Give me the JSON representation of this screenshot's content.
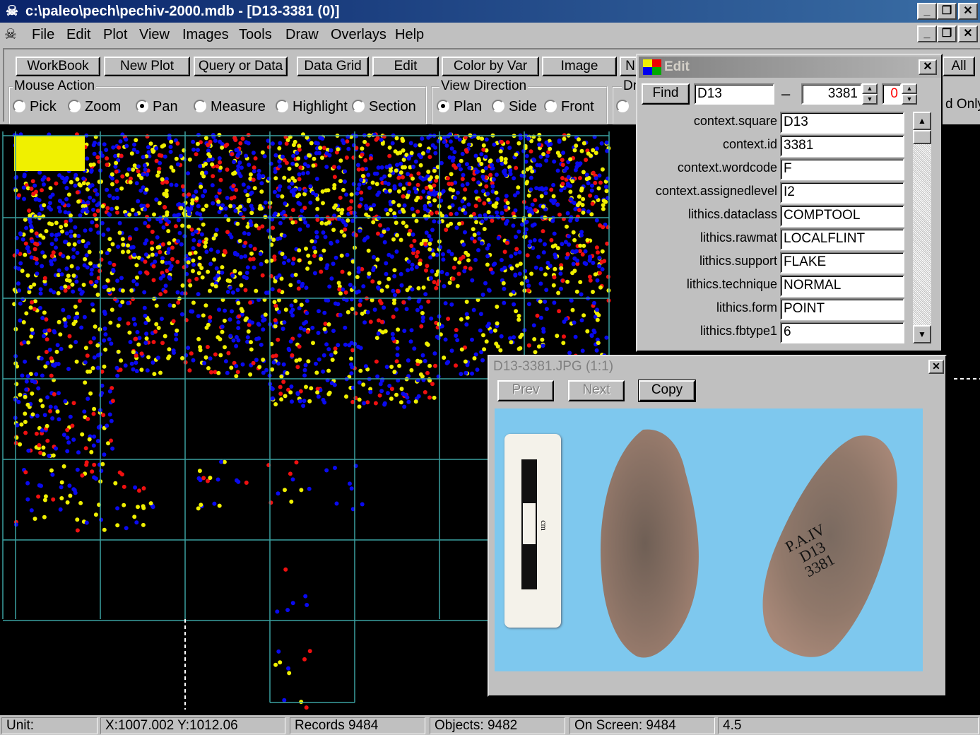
{
  "window": {
    "title": "c:\\paleo\\pech\\pechiv-2000.mdb - [D13-3381 (0)]",
    "skull_icon": "skull-icon"
  },
  "menu": [
    "File",
    "Edit",
    "Plot",
    "View",
    "Images",
    "Tools",
    "Draw",
    "Overlays",
    "Help"
  ],
  "toolbar": {
    "buttons": [
      "WorkBook",
      "New Plot",
      "Query or Data",
      "Data Grid",
      "Edit",
      "Color by Var",
      "Image",
      "N",
      "All"
    ],
    "mouse_action": {
      "label": "Mouse Action",
      "options": [
        "Pick",
        "Zoom",
        "Pan",
        "Measure",
        "Highlight",
        "Section"
      ],
      "selected": "Pan"
    },
    "view_direction": {
      "label": "View Direction",
      "options": [
        "Plan",
        "Side",
        "Front"
      ],
      "selected": "Plan"
    },
    "dr_label": "Dr",
    "d_only": "d Only"
  },
  "colors": {
    "grid": "#3aa0a0",
    "blue": "#0a0af0",
    "yellow": "#f0f000",
    "red": "#f01010",
    "bg": "#000000"
  },
  "edit_window": {
    "title": "Edit",
    "find_label": "Find",
    "find_square": "D13",
    "dash": "–",
    "find_id": "3381",
    "find_sub": "0",
    "fields": [
      {
        "label": "context.square",
        "value": "D13"
      },
      {
        "label": "context.id",
        "value": " 3381"
      },
      {
        "label": "context.wordcode",
        "value": "F"
      },
      {
        "label": "context.assignedlevel",
        "value": "I2"
      },
      {
        "label": "lithics.dataclass",
        "value": "COMPTOOL"
      },
      {
        "label": "lithics.rawmat",
        "value": "LOCALFLINT"
      },
      {
        "label": "lithics.support",
        "value": "FLAKE"
      },
      {
        "label": "lithics.technique",
        "value": "NORMAL"
      },
      {
        "label": "lithics.form",
        "value": "POINT"
      },
      {
        "label": "lithics.fbtype1",
        "value": "6"
      }
    ]
  },
  "image_window": {
    "title": "D13-3381.JPG  (1:1)",
    "prev": "Prev",
    "next": "Next",
    "copy": "Copy",
    "scale_unit": "cm",
    "artifact_label_lines": [
      "P.A.IV",
      "D13",
      "3381"
    ]
  },
  "status": {
    "unit": "Unit:",
    "coords": "X:1007.002   Y:1012.06",
    "records": "Records 9484",
    "objects": "Objects: 9482",
    "onscreen": "On Screen: 9484",
    "zoom": "4.5"
  }
}
